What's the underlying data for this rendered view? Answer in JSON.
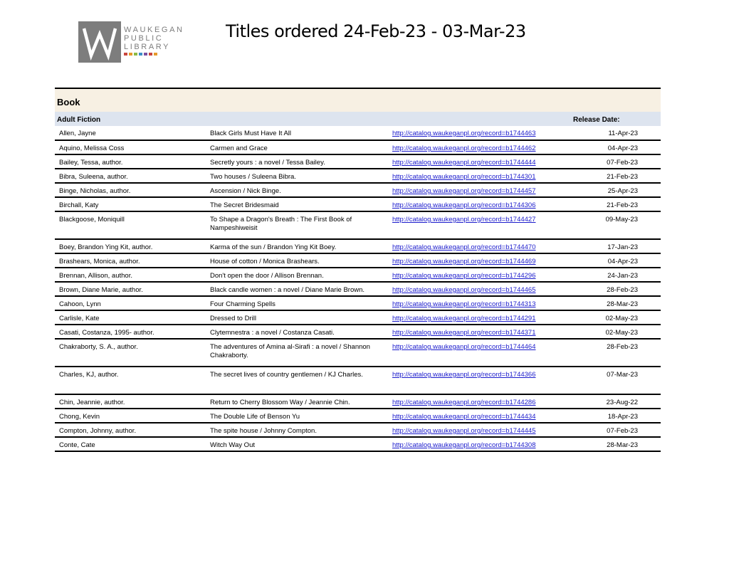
{
  "logo": {
    "lines": [
      "WAUKEGAN",
      "PUBLIC",
      "LIBRARY"
    ],
    "dot_colors": [
      "#c9463d",
      "#e59a2b",
      "#8cba45",
      "#3d8fc9",
      "#7a4fa1",
      "#c9463d",
      "#e59a2b"
    ]
  },
  "header": {
    "title": "Titles ordered 24-Feb-23 - 03-Mar-23"
  },
  "section": {
    "label": "Book"
  },
  "group": {
    "label": "Adult Fiction",
    "release_label": "Release Date:"
  },
  "rows": [
    {
      "author": "Allen, Jayne",
      "title": "Black Girls Must Have It All",
      "link": "http://catalog.waukeganpl.org/record=b1744463",
      "date": "11-Apr-23"
    },
    {
      "author": "Aquino, Melissa Coss",
      "title": "Carmen and Grace",
      "link": "http://catalog.waukeganpl.org/record=b1744462",
      "date": "04-Apr-23"
    },
    {
      "author": "Bailey, Tessa, author.",
      "title": "Secretly yours : a novel / Tessa Bailey.",
      "link": "http://catalog.waukeganpl.org/record=b1744444",
      "date": "07-Feb-23"
    },
    {
      "author": "Bibra, Suleena, author.",
      "title": "Two houses / Suleena Bibra.",
      "link": "http://catalog.waukeganpl.org/record=b1744301",
      "date": "21-Feb-23"
    },
    {
      "author": "Binge, Nicholas, author.",
      "title": "Ascension / Nick Binge.",
      "link": "http://catalog.waukeganpl.org/record=b1744457",
      "date": "25-Apr-23"
    },
    {
      "author": "Birchall, Katy",
      "title": "The Secret Bridesmaid",
      "link": "http://catalog.waukeganpl.org/record=b1744306",
      "date": "21-Feb-23"
    },
    {
      "author": "Blackgoose, Moniquill",
      "title": "To Shape a Dragon's Breath : The First Book of Nampeshiweisit",
      "link": "http://catalog.waukeganpl.org/record=b1744427",
      "date": "09-May-23"
    },
    {
      "author": "Boey, Brandon Ying Kit, author.",
      "title": "Karma of the sun / Brandon Ying Kit Boey.",
      "link": "http://catalog.waukeganpl.org/record=b1744470",
      "date": "17-Jan-23"
    },
    {
      "author": "Brashears, Monica, author.",
      "title": "House of cotton / Monica Brashears.",
      "link": "http://catalog.waukeganpl.org/record=b1744469",
      "date": "04-Apr-23"
    },
    {
      "author": "Brennan, Allison, author.",
      "title": "Don't open the door / Allison Brennan.",
      "link": "http://catalog.waukeganpl.org/record=b1744296",
      "date": "24-Jan-23"
    },
    {
      "author": "Brown, Diane Marie, author.",
      "title": "Black candle women : a novel / Diane Marie Brown.",
      "link": "http://catalog.waukeganpl.org/record=b1744465",
      "date": "28-Feb-23"
    },
    {
      "author": "Cahoon, Lynn",
      "title": "Four Charming Spells",
      "link": "http://catalog.waukeganpl.org/record=b1744313",
      "date": "28-Mar-23"
    },
    {
      "author": "Carlisle, Kate",
      "title": "Dressed to Drill",
      "link": "http://catalog.waukeganpl.org/record=b1744291",
      "date": "02-May-23"
    },
    {
      "author": "Casati, Costanza, 1995- author.",
      "title": "Clytemnestra : a novel / Costanza Casati.",
      "link": "http://catalog.waukeganpl.org/record=b1744371",
      "date": "02-May-23"
    },
    {
      "author": "Chakraborty, S. A., author.",
      "title": "The adventures of Amina al-Sirafi : a novel / Shannon Chakraborty.",
      "link": "http://catalog.waukeganpl.org/record=b1744464",
      "date": "28-Feb-23"
    },
    {
      "author": "Charles, KJ, author.",
      "title": "The secret lives of country gentlemen / KJ Charles.",
      "link": "http://catalog.waukeganpl.org/record=b1744366",
      "date": "07-Mar-23"
    },
    {
      "author": "Chin, Jeannie, author.",
      "title": "Return to Cherry Blossom Way / Jeannie Chin.",
      "link": "http://catalog.waukeganpl.org/record=b1744286",
      "date": "23-Aug-22"
    },
    {
      "author": "Chong, Kevin",
      "title": "The Double Life of Benson Yu",
      "link": "http://catalog.waukeganpl.org/record=b1744434",
      "date": "18-Apr-23"
    },
    {
      "author": "Compton, Johnny, author.",
      "title": "The spite house / Johnny Compton.",
      "link": "http://catalog.waukeganpl.org/record=b1744445",
      "date": "07-Feb-23"
    },
    {
      "author": "Conte, Cate",
      "title": "Witch Way Out",
      "link": "http://catalog.waukeganpl.org/record=b1744308",
      "date": "28-Mar-23"
    }
  ]
}
